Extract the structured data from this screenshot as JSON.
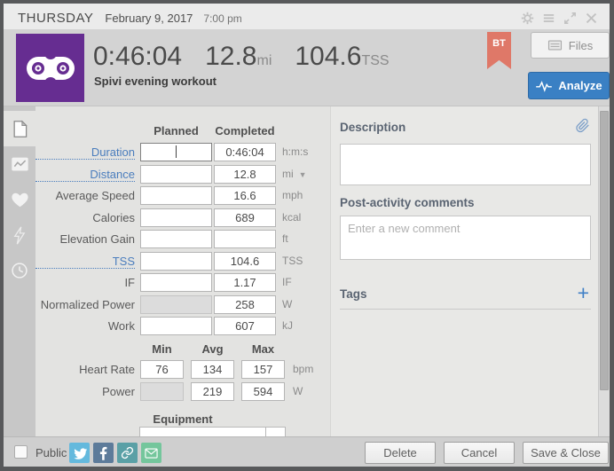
{
  "window": {
    "controls": {
      "settings": "gear-icon",
      "menu": "hamburger-icon",
      "expand": "expand-icon",
      "close": "close-icon"
    }
  },
  "header": {
    "day": "THURSDAY",
    "date": "February 9, 2017",
    "time": "7:00 pm"
  },
  "summary": {
    "duration": "0:46:04",
    "distance": "12.8",
    "distance_unit": "mi",
    "tss": "104.6",
    "tss_unit": "TSS",
    "title": "Spivi evening workout",
    "badge": "BT",
    "files_label": "Files",
    "analyze_label": "Analyze",
    "sport_icon": "bike-chain-icon",
    "colors": {
      "sport_tile": "#662d91",
      "badge_ribbon": "#df7868",
      "analyze_button": "#3a80c4"
    }
  },
  "sidebar": {
    "tabs": [
      {
        "icon": "document-icon",
        "selected": true
      },
      {
        "icon": "chart-icon",
        "selected": false
      },
      {
        "icon": "heart-icon",
        "selected": false
      },
      {
        "icon": "lightning-icon",
        "selected": false
      },
      {
        "icon": "clock-icon",
        "selected": false
      }
    ]
  },
  "form": {
    "planned_header": "Planned",
    "completed_header": "Completed",
    "rows": [
      {
        "label": "Duration",
        "planned": "",
        "completed": "0:46:04",
        "unit": "h:m:s"
      },
      {
        "label": "Distance",
        "planned": "",
        "completed": "12.8",
        "unit": "mi"
      },
      {
        "label": "Average Speed",
        "planned": "",
        "completed": "16.6",
        "unit": "mph"
      },
      {
        "label": "Calories",
        "planned": "",
        "completed": "689",
        "unit": "kcal"
      },
      {
        "label": "Elevation Gain",
        "planned": "",
        "completed": "",
        "unit": "ft"
      },
      {
        "label": "TSS",
        "planned": "",
        "completed": "104.6",
        "unit": "TSS"
      },
      {
        "label": "IF",
        "planned": "",
        "completed": "1.17",
        "unit": "IF"
      },
      {
        "label": "Normalized Power",
        "planned": "",
        "completed": "258",
        "unit": "W"
      },
      {
        "label": "Work",
        "planned": "",
        "completed": "607",
        "unit": "kJ"
      }
    ],
    "minmax": {
      "min_header": "Min",
      "avg_header": "Avg",
      "max_header": "Max",
      "rows": [
        {
          "label": "Heart Rate",
          "min": "76",
          "avg": "134",
          "max": "157",
          "unit": "bpm"
        },
        {
          "label": "Power",
          "min": "",
          "avg": "219",
          "max": "594",
          "unit": "W"
        }
      ]
    },
    "equipment_header": "Equipment"
  },
  "right": {
    "description_label": "Description",
    "description_value": "",
    "comments_label": "Post-activity comments",
    "comment_placeholder": "Enter a new comment",
    "tags_label": "Tags"
  },
  "footer": {
    "public_label": "Public",
    "social_icons": [
      "twitter-icon",
      "facebook-icon",
      "link-icon",
      "email-icon"
    ],
    "social_colors": {
      "twitter": "#64b9dd",
      "facebook": "#5d7b9a",
      "link": "#5aa0a6",
      "email": "#74c69c"
    },
    "delete_label": "Delete",
    "cancel_label": "Cancel",
    "save_label": "Save & Close"
  }
}
